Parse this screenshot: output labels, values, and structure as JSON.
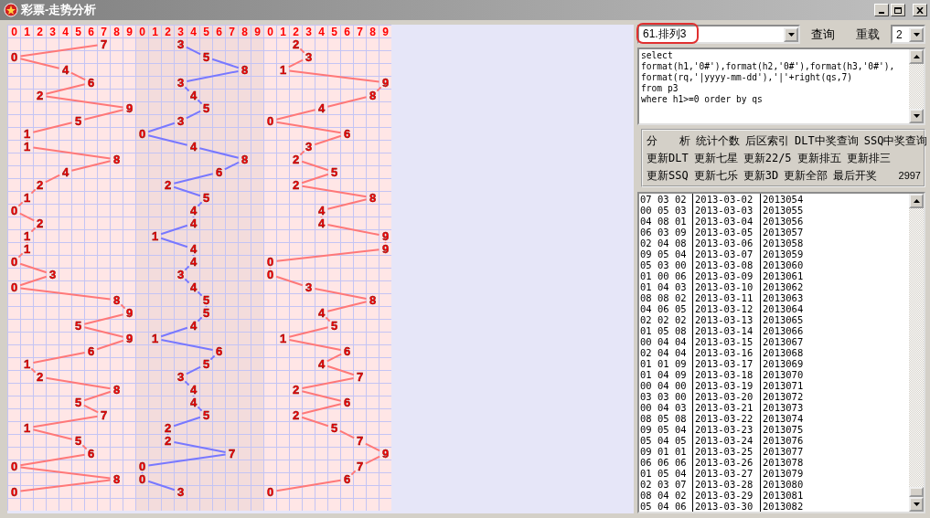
{
  "window": {
    "title": "彩票-走势分析"
  },
  "trend": {
    "positions": [
      {
        "color": "#ff7878",
        "shaded": false,
        "header": [
          "0",
          "1",
          "2",
          "3",
          "4",
          "5",
          "6",
          "7",
          "8",
          "9"
        ]
      },
      {
        "color": "#7878ff",
        "shaded": true,
        "header": [
          "0",
          "1",
          "2",
          "3",
          "4",
          "5",
          "6",
          "7",
          "8",
          "9"
        ]
      },
      {
        "color": "#ff7878",
        "shaded": false,
        "header": [
          "0",
          "1",
          "2",
          "3",
          "4",
          "5",
          "6",
          "7",
          "8",
          "9"
        ]
      }
    ],
    "draws": [
      [
        "7",
        "3",
        "2"
      ],
      [
        "0",
        "5",
        "3"
      ],
      [
        "4",
        "8",
        "1"
      ],
      [
        "6",
        "3",
        "9"
      ],
      [
        "2",
        "4",
        "8"
      ],
      [
        "9",
        "5",
        "4"
      ],
      [
        "5",
        "3",
        "0"
      ],
      [
        "1",
        "0",
        "6"
      ],
      [
        "1",
        "4",
        "3"
      ],
      [
        "8",
        "8",
        "2"
      ],
      [
        "4",
        "6",
        "5"
      ],
      [
        "2",
        "2",
        "2"
      ],
      [
        "1",
        "5",
        "8"
      ],
      [
        "0",
        "4",
        "4"
      ],
      [
        "2",
        "4",
        "4"
      ],
      [
        "1",
        "1",
        "9"
      ],
      [
        "1",
        "4",
        "9"
      ],
      [
        "0",
        "4",
        "0"
      ],
      [
        "3",
        "3",
        "0"
      ],
      [
        "0",
        "4",
        "3"
      ],
      [
        "8",
        "5",
        "8"
      ],
      [
        "9",
        "5",
        "4"
      ],
      [
        "5",
        "4",
        "5"
      ],
      [
        "9",
        "1",
        "1"
      ],
      [
        "6",
        "6",
        "6"
      ],
      [
        "1",
        "5",
        "4"
      ],
      [
        "2",
        "3",
        "7"
      ],
      [
        "8",
        "4",
        "2"
      ],
      [
        "5",
        "4",
        "6"
      ],
      [
        "7",
        "5",
        "2"
      ],
      [
        "1",
        "2",
        "5"
      ],
      [
        "5",
        "2",
        "7"
      ],
      [
        "6",
        "7",
        "9"
      ],
      [
        "0",
        "0",
        "7"
      ],
      [
        "8",
        "0",
        "6"
      ],
      [
        "0",
        "3",
        "0"
      ]
    ]
  },
  "query": {
    "table_select": {
      "value": "61.排列3"
    },
    "query_button": "查询",
    "reload_button": "重载",
    "count_select": {
      "value": "2"
    },
    "sql": [
      "select",
      "format(h1,'0#'),format(h2,'0#'),format(h3,'0#'),",
      "format(rq,'|yyyy-mm-dd'),'|'+right(qs,7)",
      "from p3",
      "where h1>=0 order by qs"
    ]
  },
  "actions": [
    [
      "分　　析",
      "统计个数",
      "后区索引",
      "DLT中奖查询",
      "SSQ中奖查询"
    ],
    [
      "更新DLT",
      "更新七星",
      "更新22/5",
      "更新排五",
      "更新排三"
    ],
    [
      "更新SSQ",
      "更新七乐",
      "更新3D",
      "更新全部",
      "最后开奖"
    ]
  ],
  "total": "2997",
  "results": [
    {
      "numbers": "07 03 02",
      "date": "2013-03-02",
      "issue": "2013054"
    },
    {
      "numbers": "00 05 03",
      "date": "2013-03-03",
      "issue": "2013055"
    },
    {
      "numbers": "04 08 01",
      "date": "2013-03-04",
      "issue": "2013056"
    },
    {
      "numbers": "06 03 09",
      "date": "2013-03-05",
      "issue": "2013057"
    },
    {
      "numbers": "02 04 08",
      "date": "2013-03-06",
      "issue": "2013058"
    },
    {
      "numbers": "09 05 04",
      "date": "2013-03-07",
      "issue": "2013059"
    },
    {
      "numbers": "05 03 00",
      "date": "2013-03-08",
      "issue": "2013060"
    },
    {
      "numbers": "01 00 06",
      "date": "2013-03-09",
      "issue": "2013061"
    },
    {
      "numbers": "01 04 03",
      "date": "2013-03-10",
      "issue": "2013062"
    },
    {
      "numbers": "08 08 02",
      "date": "2013-03-11",
      "issue": "2013063"
    },
    {
      "numbers": "04 06 05",
      "date": "2013-03-12",
      "issue": "2013064"
    },
    {
      "numbers": "02 02 02",
      "date": "2013-03-13",
      "issue": "2013065"
    },
    {
      "numbers": "01 05 08",
      "date": "2013-03-14",
      "issue": "2013066"
    },
    {
      "numbers": "00 04 04",
      "date": "2013-03-15",
      "issue": "2013067"
    },
    {
      "numbers": "02 04 04",
      "date": "2013-03-16",
      "issue": "2013068"
    },
    {
      "numbers": "01 01 09",
      "date": "2013-03-17",
      "issue": "2013069"
    },
    {
      "numbers": "01 04 09",
      "date": "2013-03-18",
      "issue": "2013070"
    },
    {
      "numbers": "00 04 00",
      "date": "2013-03-19",
      "issue": "2013071"
    },
    {
      "numbers": "03 03 00",
      "date": "2013-03-20",
      "issue": "2013072"
    },
    {
      "numbers": "00 04 03",
      "date": "2013-03-21",
      "issue": "2013073"
    },
    {
      "numbers": "08 05 08",
      "date": "2013-03-22",
      "issue": "2013074"
    },
    {
      "numbers": "09 05 04",
      "date": "2013-03-23",
      "issue": "2013075"
    },
    {
      "numbers": "05 04 05",
      "date": "2013-03-24",
      "issue": "2013076"
    },
    {
      "numbers": "09 01 01",
      "date": "2013-03-25",
      "issue": "2013077"
    },
    {
      "numbers": "06 06 06",
      "date": "2013-03-26",
      "issue": "2013078"
    },
    {
      "numbers": "01 05 04",
      "date": "2013-03-27",
      "issue": "2013079"
    },
    {
      "numbers": "02 03 07",
      "date": "2013-03-28",
      "issue": "2013080"
    },
    {
      "numbers": "08 04 02",
      "date": "2013-03-29",
      "issue": "2013081"
    },
    {
      "numbers": "05 04 06",
      "date": "2013-03-30",
      "issue": "2013082"
    }
  ]
}
